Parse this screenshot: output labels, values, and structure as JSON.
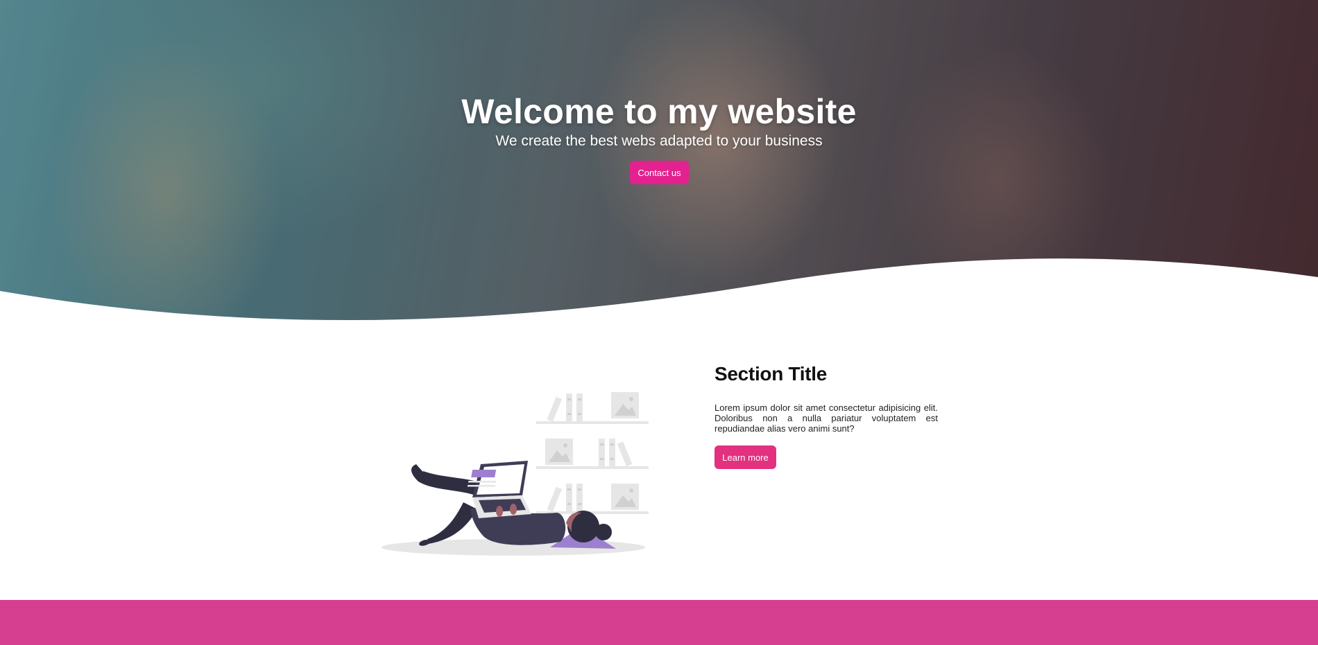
{
  "hero": {
    "title": "Welcome to my website",
    "subtitle": "We create the best webs adapted to your business",
    "button_label": "Contact us"
  },
  "section": {
    "title": "Section Title",
    "body": "Lorem ipsum dolor sit amet consectetur adipisicing elit. Doloribus non a nulla pariatur voluptatem est repudiandae alias vero animi sunt?",
    "button_label": "Learn more"
  },
  "colors": {
    "accent": "#e3218f",
    "accent_button": "#e3307f",
    "footer": "#d63e8f",
    "illustration_purple": "#9d7fd0"
  },
  "icons": {
    "hero_image": "people-laughing-photo",
    "illustration": "person-lying-with-laptop"
  }
}
